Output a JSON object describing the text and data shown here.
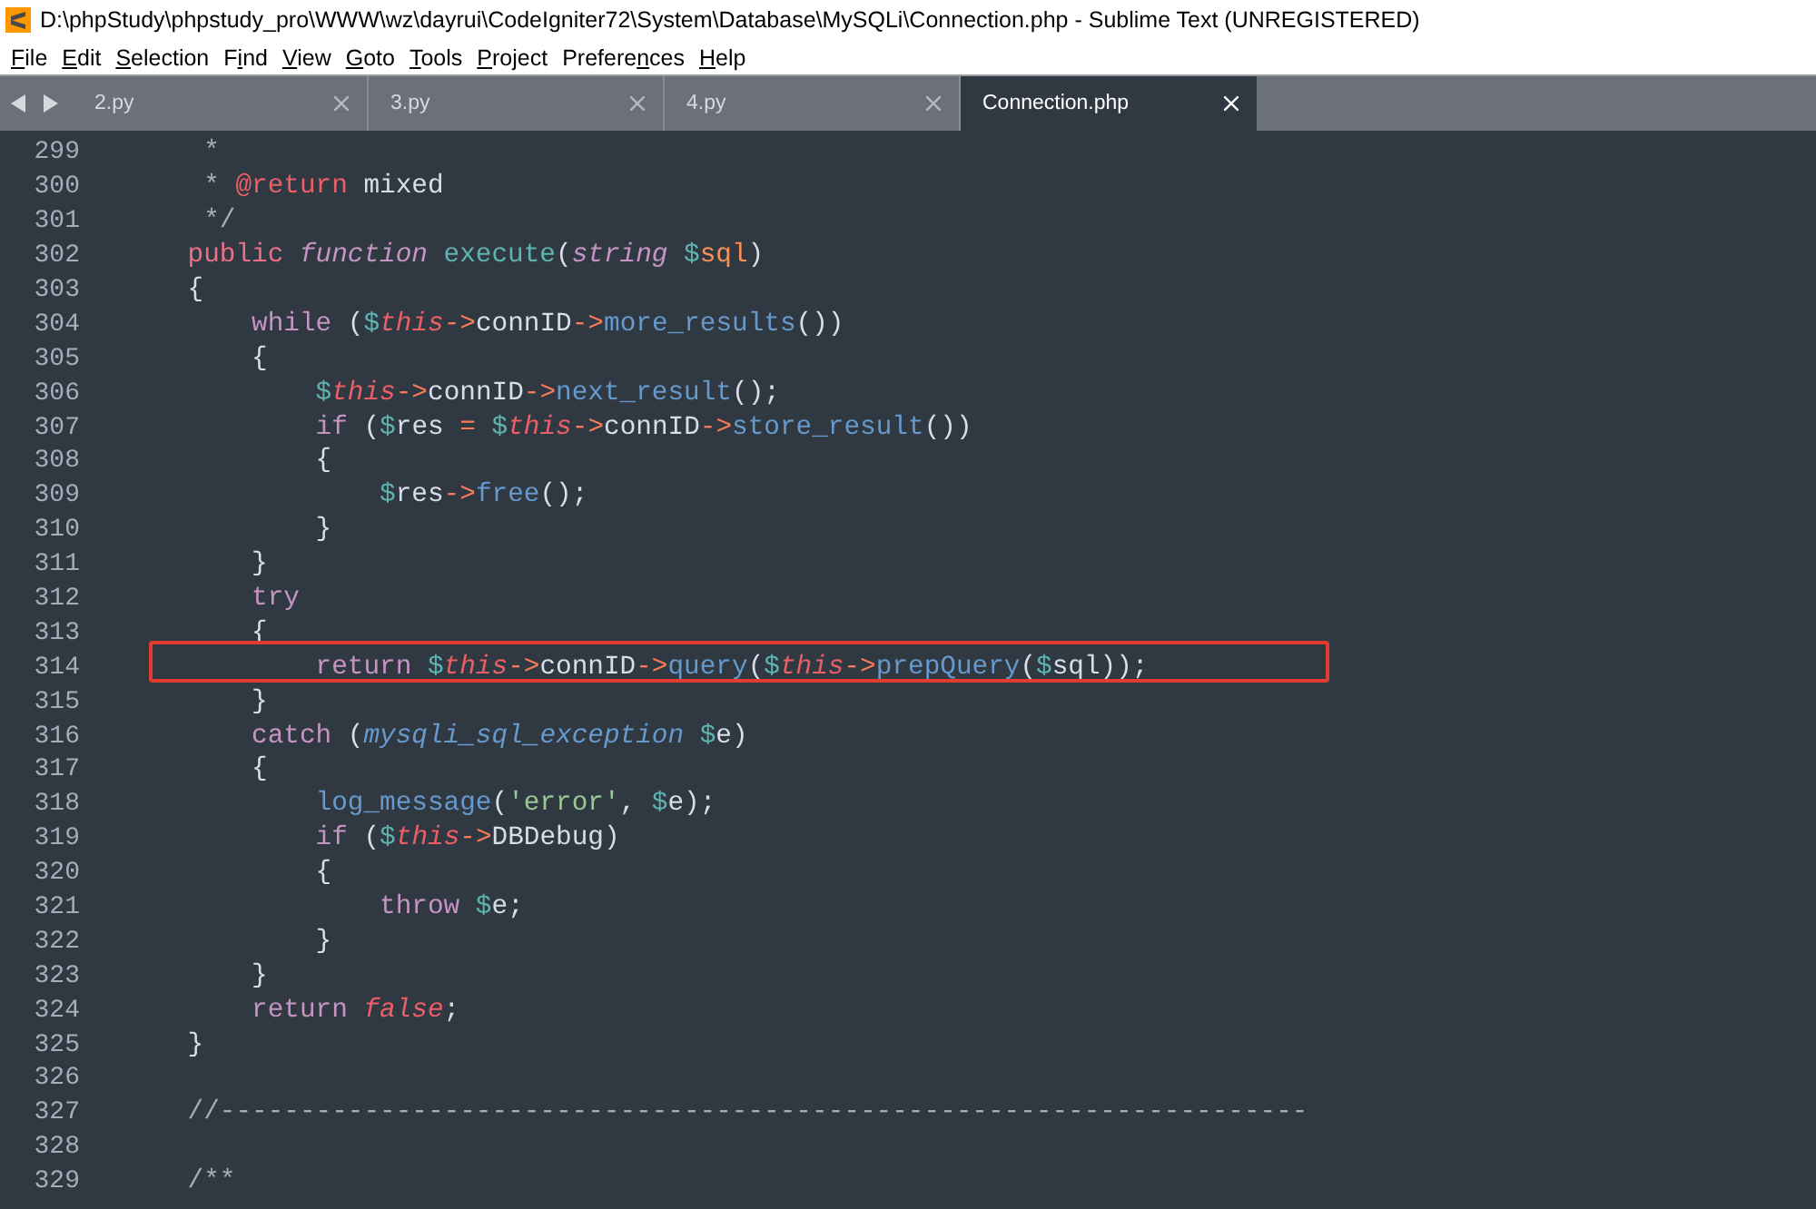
{
  "window": {
    "title": "D:\\phpStudy\\phpstudy_pro\\WWW\\wz\\dayrui\\CodeIgniter72\\System\\Database\\MySQLi\\Connection.php - Sublime Text (UNREGISTERED)"
  },
  "menu": [
    {
      "key": "F",
      "after": "ile"
    },
    {
      "key": "E",
      "after": "dit"
    },
    {
      "key": "S",
      "after": "election"
    },
    {
      "before": "F",
      "key": "i",
      "after": "nd"
    },
    {
      "key": "V",
      "after": "iew"
    },
    {
      "key": "G",
      "after": "oto"
    },
    {
      "key": "T",
      "after": "ools"
    },
    {
      "key": "P",
      "after": "roject"
    },
    {
      "before": "Prefere",
      "key": "n",
      "after": "ces"
    },
    {
      "key": "H",
      "after": "elp"
    }
  ],
  "tabs": [
    {
      "label": "2.py",
      "selected": false
    },
    {
      "label": "3.py",
      "selected": false
    },
    {
      "label": "4.py",
      "selected": false
    },
    {
      "label": "Connection.php",
      "selected": true
    }
  ],
  "lines": [
    {
      "number": "299",
      "tokens": [
        {
          "text": "     *",
          "kind": "comment"
        }
      ]
    },
    {
      "number": "300",
      "tokens": [
        {
          "text": "     *",
          "kind": "comment"
        },
        {
          "text": " @return",
          "kind": "tag"
        },
        {
          "text": " mixed",
          "kind": "plain"
        }
      ]
    },
    {
      "number": "301",
      "tokens": [
        {
          "text": "     */",
          "kind": "comment"
        }
      ]
    },
    {
      "number": "302",
      "tokens": [
        {
          "text": "    public",
          "kind": "modifier"
        },
        {
          "text": " function",
          "kind": "storage"
        },
        {
          "text": " execute",
          "kind": "function"
        },
        {
          "text": "(",
          "kind": "plain"
        },
        {
          "text": "string",
          "kind": "storage"
        },
        {
          "text": " $",
          "kind": "var"
        },
        {
          "text": "sql",
          "kind": "param"
        },
        {
          "text": ")",
          "kind": "plain"
        }
      ]
    },
    {
      "number": "303",
      "tokens": [
        {
          "text": "    {",
          "kind": "plain"
        }
      ]
    },
    {
      "number": "304",
      "tokens": [
        {
          "text": "        while",
          "kind": "keyword"
        },
        {
          "text": " (",
          "kind": "plain"
        },
        {
          "text": "$",
          "kind": "var"
        },
        {
          "text": "this",
          "kind": "this"
        },
        {
          "text": "->",
          "kind": "arrow"
        },
        {
          "text": "connID",
          "kind": "plain"
        },
        {
          "text": "->",
          "kind": "arrow"
        },
        {
          "text": "more_results",
          "kind": "call"
        },
        {
          "text": "())",
          "kind": "plain"
        }
      ]
    },
    {
      "number": "305",
      "tokens": [
        {
          "text": "        {",
          "kind": "plain"
        }
      ]
    },
    {
      "number": "306",
      "tokens": [
        {
          "text": "            $",
          "kind": "var"
        },
        {
          "text": "this",
          "kind": "this"
        },
        {
          "text": "->",
          "kind": "arrow"
        },
        {
          "text": "connID",
          "kind": "plain"
        },
        {
          "text": "->",
          "kind": "arrow"
        },
        {
          "text": "next_result",
          "kind": "call"
        },
        {
          "text": "();",
          "kind": "plain"
        }
      ]
    },
    {
      "number": "307",
      "tokens": [
        {
          "text": "            if",
          "kind": "keyword"
        },
        {
          "text": " (",
          "kind": "plain"
        },
        {
          "text": "$",
          "kind": "var"
        },
        {
          "text": "res ",
          "kind": "plain"
        },
        {
          "text": "=",
          "kind": "arrow"
        },
        {
          "text": " $",
          "kind": "var"
        },
        {
          "text": "this",
          "kind": "this"
        },
        {
          "text": "->",
          "kind": "arrow"
        },
        {
          "text": "connID",
          "kind": "plain"
        },
        {
          "text": "->",
          "kind": "arrow"
        },
        {
          "text": "store_result",
          "kind": "call"
        },
        {
          "text": "())",
          "kind": "plain"
        }
      ]
    },
    {
      "number": "308",
      "tokens": [
        {
          "text": "            {",
          "kind": "plain"
        }
      ]
    },
    {
      "number": "309",
      "tokens": [
        {
          "text": "                $",
          "kind": "var"
        },
        {
          "text": "res",
          "kind": "plain"
        },
        {
          "text": "->",
          "kind": "arrow"
        },
        {
          "text": "free",
          "kind": "call"
        },
        {
          "text": "();",
          "kind": "plain"
        }
      ]
    },
    {
      "number": "310",
      "tokens": [
        {
          "text": "            }",
          "kind": "plain"
        }
      ]
    },
    {
      "number": "311",
      "tokens": [
        {
          "text": "        }",
          "kind": "plain"
        }
      ]
    },
    {
      "number": "312",
      "tokens": [
        {
          "text": "        try",
          "kind": "keyword"
        }
      ]
    },
    {
      "number": "313",
      "tokens": [
        {
          "text": "        {",
          "kind": "plain"
        }
      ]
    },
    {
      "number": "314",
      "highlighted": true,
      "tokens": [
        {
          "text": "            return",
          "kind": "keyword"
        },
        {
          "text": " $",
          "kind": "var"
        },
        {
          "text": "this",
          "kind": "this"
        },
        {
          "text": "->",
          "kind": "arrow"
        },
        {
          "text": "connID",
          "kind": "plain"
        },
        {
          "text": "->",
          "kind": "arrow"
        },
        {
          "text": "query",
          "kind": "call"
        },
        {
          "text": "(",
          "kind": "plain"
        },
        {
          "text": "$",
          "kind": "var"
        },
        {
          "text": "this",
          "kind": "this"
        },
        {
          "text": "->",
          "kind": "arrow"
        },
        {
          "text": "prepQuery",
          "kind": "call"
        },
        {
          "text": "(",
          "kind": "plain"
        },
        {
          "text": "$",
          "kind": "var"
        },
        {
          "text": "sql));",
          "kind": "plain"
        }
      ]
    },
    {
      "number": "315",
      "tokens": [
        {
          "text": "        }",
          "kind": "plain"
        }
      ]
    },
    {
      "number": "316",
      "tokens": [
        {
          "text": "        catch",
          "kind": "keyword"
        },
        {
          "text": " (",
          "kind": "plain"
        },
        {
          "text": "mysqli_sql_exception",
          "kind": "type"
        },
        {
          "text": " $",
          "kind": "var"
        },
        {
          "text": "e)",
          "kind": "plain"
        }
      ]
    },
    {
      "number": "317",
      "tokens": [
        {
          "text": "        {",
          "kind": "plain"
        }
      ]
    },
    {
      "number": "318",
      "tokens": [
        {
          "text": "            log_message",
          "kind": "call"
        },
        {
          "text": "(",
          "kind": "plain"
        },
        {
          "text": "'error'",
          "kind": "string"
        },
        {
          "text": ", ",
          "kind": "plain"
        },
        {
          "text": "$",
          "kind": "var"
        },
        {
          "text": "e);",
          "kind": "plain"
        }
      ]
    },
    {
      "number": "319",
      "tokens": [
        {
          "text": "            if",
          "kind": "keyword"
        },
        {
          "text": " (",
          "kind": "plain"
        },
        {
          "text": "$",
          "kind": "var"
        },
        {
          "text": "this",
          "kind": "this"
        },
        {
          "text": "->",
          "kind": "arrow"
        },
        {
          "text": "DBDebug)",
          "kind": "plain"
        }
      ]
    },
    {
      "number": "320",
      "tokens": [
        {
          "text": "            {",
          "kind": "plain"
        }
      ]
    },
    {
      "number": "321",
      "tokens": [
        {
          "text": "                throw",
          "kind": "keyword"
        },
        {
          "text": " $",
          "kind": "var"
        },
        {
          "text": "e;",
          "kind": "plain"
        }
      ]
    },
    {
      "number": "322",
      "tokens": [
        {
          "text": "            }",
          "kind": "plain"
        }
      ]
    },
    {
      "number": "323",
      "tokens": [
        {
          "text": "        }",
          "kind": "plain"
        }
      ]
    },
    {
      "number": "324",
      "tokens": [
        {
          "text": "        return",
          "kind": "keyword"
        },
        {
          "text": " false",
          "kind": "constant"
        },
        {
          "text": ";",
          "kind": "plain"
        }
      ]
    },
    {
      "number": "325",
      "tokens": [
        {
          "text": "    }",
          "kind": "plain"
        }
      ]
    },
    {
      "number": "326"
    },
    {
      "number": "327",
      "tokens": [
        {
          "text": "    //--------------------------------------------------------------------",
          "kind": "comment"
        }
      ]
    },
    {
      "number": "328"
    },
    {
      "number": "329",
      "tokens": [
        {
          "text": "    /**",
          "kind": "comment"
        }
      ]
    }
  ]
}
